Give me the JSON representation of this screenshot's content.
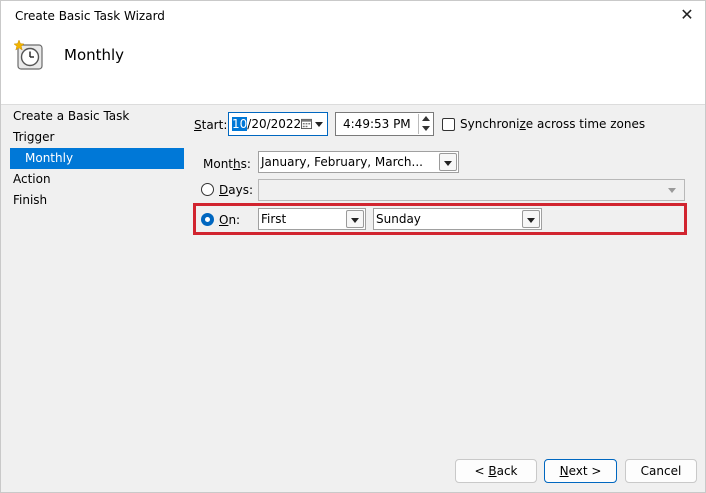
{
  "window": {
    "title": "Create Basic Task Wizard",
    "close_glyph": "✕"
  },
  "header": {
    "heading": "Monthly",
    "icon": "clock-icon"
  },
  "nav": {
    "items": [
      {
        "label": "Create a Basic Task"
      },
      {
        "label": "Trigger"
      },
      {
        "label": "Monthly"
      },
      {
        "label": "Action"
      },
      {
        "label": "Finish"
      }
    ]
  },
  "start": {
    "label_u": "S",
    "label_rest": "tart:",
    "date_selected": "10",
    "date_rest": "/20/2022",
    "time": "4:49:53 PM",
    "sync_label_pre": "Synchroni",
    "sync_label_u": "z",
    "sync_label_post": "e across time zones",
    "sync_checked": false
  },
  "months": {
    "label_pre": "Mont",
    "label_u": "h",
    "label_post": "s:",
    "value": "January, February, March..."
  },
  "days": {
    "label_u": "D",
    "label_rest": "ays:",
    "selected": false,
    "value": ""
  },
  "on": {
    "label_u": "O",
    "label_rest": "n:",
    "selected": true,
    "week": "First",
    "weekday": "Sunday"
  },
  "buttons": {
    "back_pre": "< ",
    "back_u": "B",
    "back_post": "ack",
    "next_u": "N",
    "next_post": "ext >",
    "cancel": "Cancel"
  },
  "colors": {
    "accent": "#0078d7",
    "highlight": "#d1242f"
  }
}
